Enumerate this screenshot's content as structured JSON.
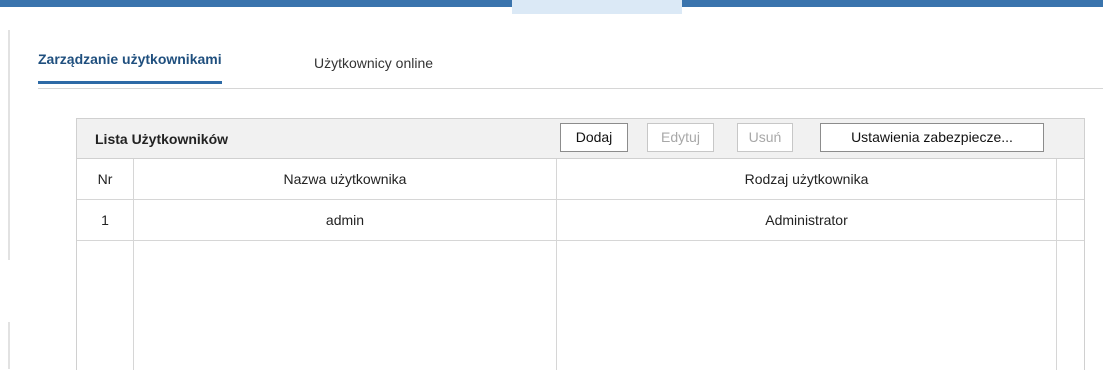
{
  "tabs": [
    {
      "label": "Zarządzanie użytkownikami",
      "active": true
    },
    {
      "label": "Użytkownicy online",
      "active": false
    }
  ],
  "panel": {
    "title": "Lista Użytkowników",
    "buttons": {
      "add": "Dodaj",
      "edit": "Edytuj",
      "delete": "Usuń",
      "security": "Ustawienia zabezpiecze..."
    }
  },
  "table": {
    "columns": [
      "Nr",
      "Nazwa użytkownika",
      "Rodzaj użytkownika"
    ],
    "rows": [
      {
        "nr": "1",
        "name": "admin",
        "type": "Administrator"
      }
    ]
  },
  "colors": {
    "accent": "#3a74ad",
    "active_tab_text": "#1f4f7e",
    "header_bg": "#f1f1f1"
  }
}
